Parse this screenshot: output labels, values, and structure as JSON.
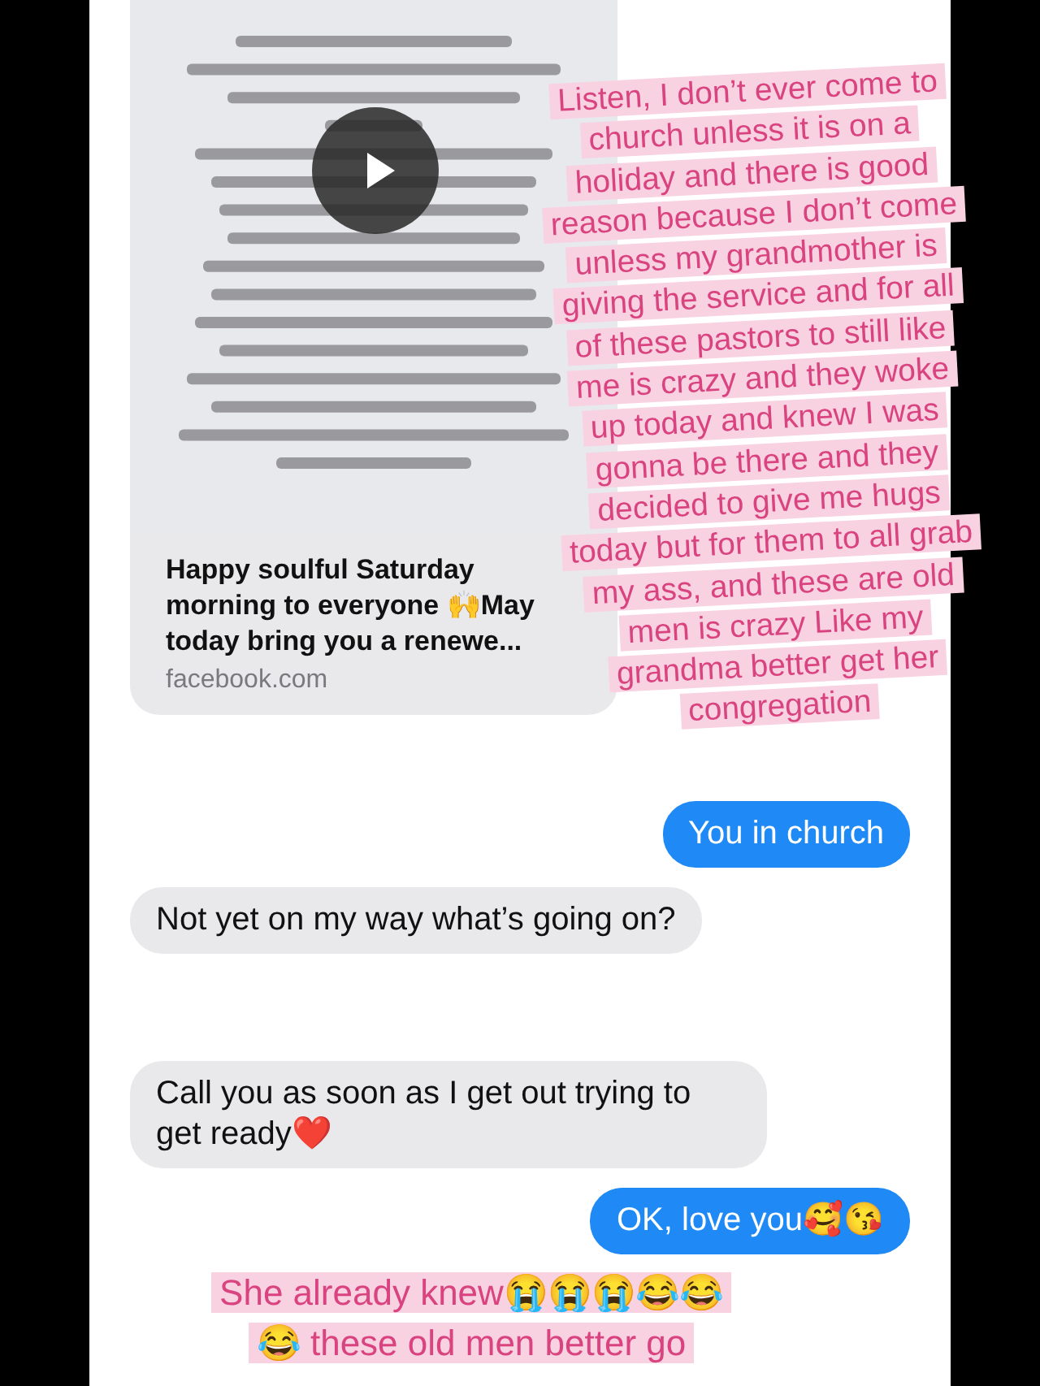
{
  "messages": [
    {
      "kind": "link_preview",
      "from_me": false,
      "title": "Happy soulful Saturday morning to everyone 🙌May today bring you a renewe...",
      "domain": "facebook.com"
    },
    {
      "kind": "text",
      "from_me": true,
      "text": "You in church"
    },
    {
      "kind": "text",
      "from_me": false,
      "text": "Not yet on my way what’s going on?"
    },
    {
      "kind": "text",
      "from_me": false,
      "text": "Call you as soon as I get out trying to get ready❤️"
    },
    {
      "kind": "text",
      "from_me": true,
      "text": "OK, love you🥰😘"
    }
  ],
  "captions": [
    {
      "lines": [
        "Listen, I don’t ever come to",
        "church unless it is on a",
        "holiday and there is good",
        "reason because I don’t come",
        "unless my grandmother is",
        "giving the service and for all",
        "of these pastors to still like",
        "me is crazy and they woke",
        "up today and knew I was",
        "gonna be there and they",
        "decided to give me hugs",
        "today but for them to all grab",
        "my ass, and these are old",
        "men is crazy Like my",
        "grandma better get her",
        "congregation"
      ]
    },
    {
      "lines": [
        "She already knew😭😭😭😂😂",
        "😂 these old men better go"
      ]
    }
  ]
}
